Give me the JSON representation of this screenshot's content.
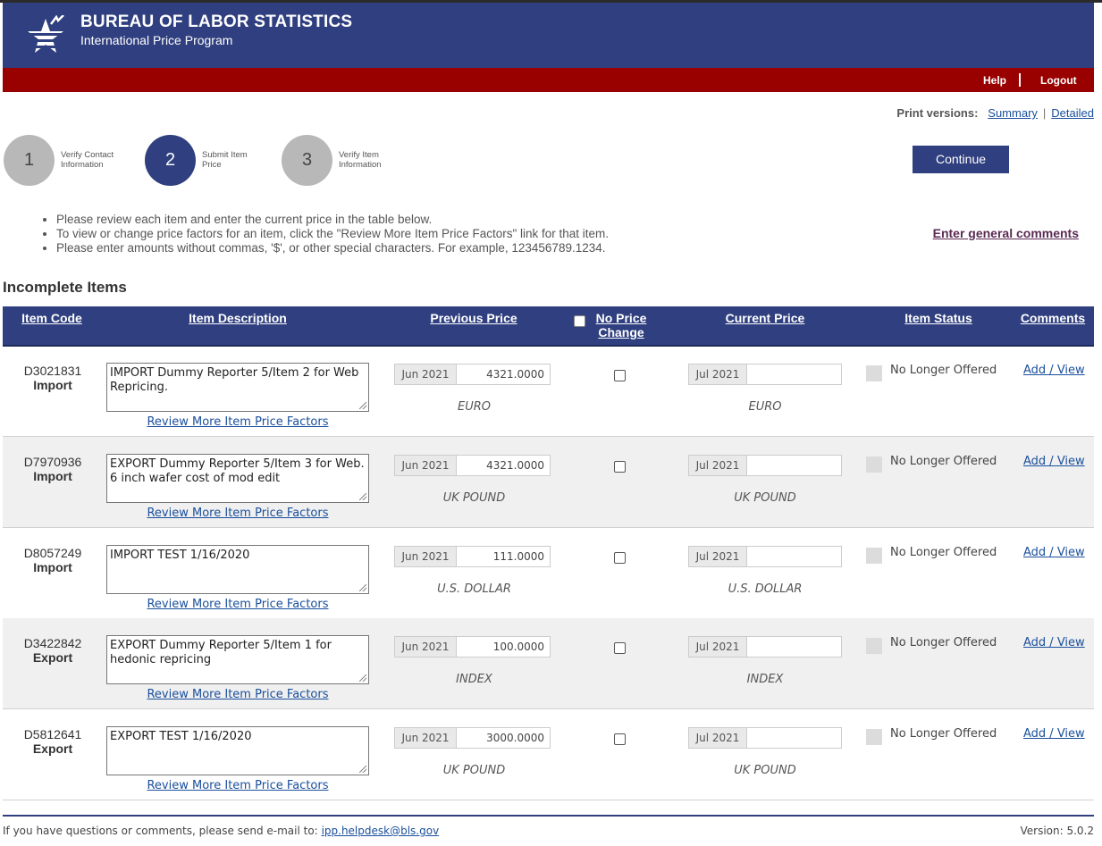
{
  "header": {
    "title": "BUREAU OF LABOR STATISTICS",
    "subtitle": "International Price Program",
    "nav": {
      "help": "Help",
      "logout": "Logout"
    }
  },
  "print_versions": {
    "label": "Print versions:",
    "summary": "Summary",
    "detailed": "Detailed"
  },
  "steps": [
    {
      "number": "1",
      "label": "Verify Contact Information",
      "state": "inactive"
    },
    {
      "number": "2",
      "label": "Submit Item Price",
      "state": "active"
    },
    {
      "number": "3",
      "label": "Verify Item Information",
      "state": "inactive"
    }
  ],
  "continue_label": "Continue",
  "instructions": [
    "Please review each item and enter the current price in the table below.",
    "To view or change price factors for an item, click the \"Review More Item Price Factors\" link for that item.",
    "Please enter amounts without commas, '$', or other special characters. For example, 123456789.1234."
  ],
  "general_comments_link": "Enter general comments",
  "section_title": "Incomplete Items",
  "table": {
    "headers": {
      "item_code": "Item Code",
      "item_description": "Item Description",
      "previous_price": "Previous Price",
      "no_price_change": "No Price Change",
      "current_price": "Current Price",
      "item_status": "Item Status",
      "comments": "Comments"
    },
    "review_link_label": "Review More Item Price Factors",
    "status_label": "No Longer Offered",
    "comments_link_label": "Add / View",
    "rows": [
      {
        "code": "D3021831",
        "type": "Import",
        "description": "IMPORT Dummy Reporter 5/Item 2 for Web Repricing.",
        "prev_period": "Jun 2021",
        "prev_price": "4321.0000",
        "unit": "EURO",
        "curr_period": "Jul 2021",
        "curr_price": ""
      },
      {
        "code": "D7970936",
        "type": "Import",
        "description": "EXPORT Dummy Reporter 5/Item 3 for Web. 6 inch wafer cost of mod edit",
        "prev_period": "Jun 2021",
        "prev_price": "4321.0000",
        "unit": "UK POUND",
        "curr_period": "Jul 2021",
        "curr_price": ""
      },
      {
        "code": "D8057249",
        "type": "Import",
        "description": "IMPORT TEST 1/16/2020",
        "prev_period": "Jun 2021",
        "prev_price": "111.0000",
        "unit": "U.S. DOLLAR",
        "curr_period": "Jul 2021",
        "curr_price": ""
      },
      {
        "code": "D3422842",
        "type": "Export",
        "description": "EXPORT Dummy Reporter  5/Item 1 for hedonic repricing",
        "prev_period": "Jun 2021",
        "prev_price": "100.0000",
        "unit": "INDEX",
        "curr_period": "Jul 2021",
        "curr_price": ""
      },
      {
        "code": "D5812641",
        "type": "Export",
        "description": "EXPORT TEST 1/16/2020",
        "prev_period": "Jun 2021",
        "prev_price": "3000.0000",
        "unit": "UK POUND",
        "curr_period": "Jul 2021",
        "curr_price": ""
      }
    ]
  },
  "footer": {
    "text": "If you have questions or comments, please send e-mail to:",
    "email": "ipp.helpdesk@bls.gov",
    "version": "Version: 5.0.2"
  },
  "colors": {
    "brand_blue": "#2f3f7f",
    "brand_red": "#990000",
    "link": "#1a4f9c"
  }
}
